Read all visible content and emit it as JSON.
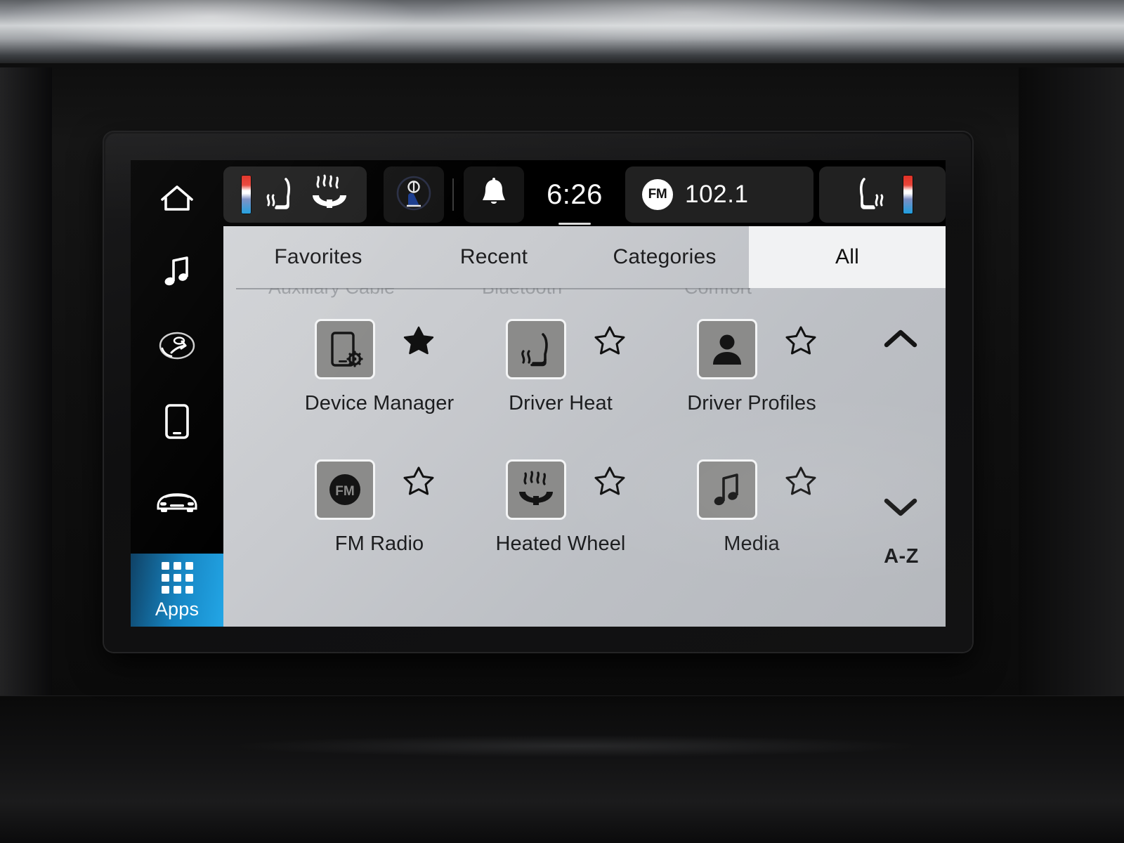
{
  "status_bar": {
    "left_climate": {
      "name": "driver-climate-control",
      "temp_bar": "temperature-gradient",
      "icons": [
        "heated-seat-icon",
        "heated-steering-wheel-icon"
      ]
    },
    "seatbelt_icon": "seatbelt-reminder-icon",
    "notifications_icon": "bell-icon",
    "time": "6:26",
    "radio": {
      "band": "FM",
      "frequency": "102.1"
    },
    "right_climate": {
      "name": "passenger-climate-control",
      "icons": [
        "heated-seat-icon"
      ],
      "temp_bar": "temperature-gradient"
    },
    "drag_handle": "panel-drag-handle"
  },
  "sidebar": {
    "items": [
      {
        "label": "Home",
        "icon": "home-icon"
      },
      {
        "label": "Audio",
        "icon": "music-note-icon"
      },
      {
        "label": "Climate",
        "icon": "seat-airflow-icon"
      },
      {
        "label": "Phone",
        "icon": "phone-icon"
      },
      {
        "label": "Vehicle",
        "icon": "car-icon"
      }
    ],
    "apps_tile": {
      "label": "Apps",
      "icon": "app-grid-icon",
      "selected": true,
      "gradient_from": "#0c3f63",
      "gradient_to": "#23a6e6"
    }
  },
  "tabs": {
    "items": [
      {
        "label": "Favorites",
        "selected": false
      },
      {
        "label": "Recent",
        "selected": false
      },
      {
        "label": "Categories",
        "selected": false
      },
      {
        "label": "All",
        "selected": true
      }
    ]
  },
  "app_grid": {
    "clipped_labels": [
      "Auxiliary Cable",
      "Bluetooth",
      "Comfort"
    ],
    "apps": [
      {
        "label": "Device Manager",
        "icon": "device-manager-icon",
        "favorite": true
      },
      {
        "label": "Driver Heat",
        "icon": "heated-seat-icon",
        "favorite": false
      },
      {
        "label": "Driver Profiles",
        "icon": "person-icon",
        "favorite": false
      },
      {
        "label": "FM Radio",
        "icon": "fm-radio-icon",
        "favorite": false
      },
      {
        "label": "Heated Wheel",
        "icon": "heated-wheel-icon",
        "favorite": false
      },
      {
        "label": "Media",
        "icon": "music-note-icon",
        "favorite": false
      }
    ],
    "scroll_up": "chevron-up-icon",
    "scroll_down": "chevron-down-icon",
    "sort_label": "A-Z"
  },
  "colors": {
    "accent_blue": "#23a6e6",
    "panel_light": "#c9cbcf",
    "tab_selected": "#f1f2f3",
    "tile_gray": "#8b8b8a",
    "status_pill": "#212121"
  }
}
